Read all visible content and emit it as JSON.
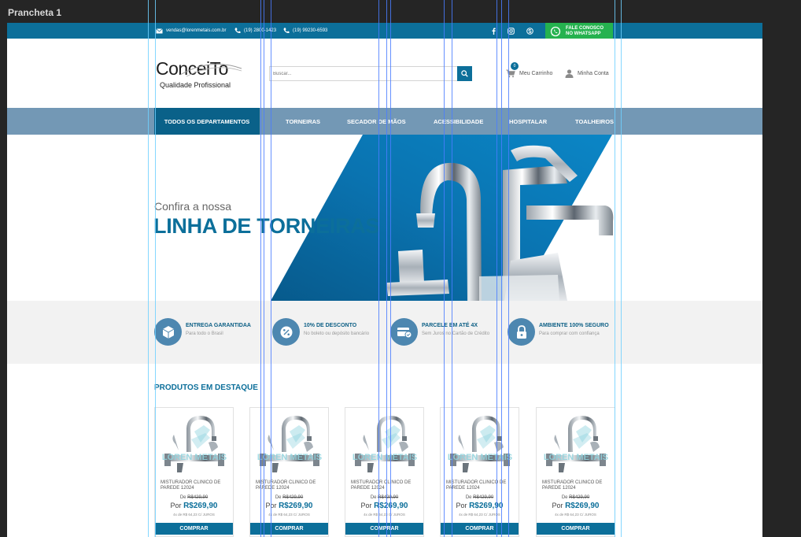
{
  "artboard": {
    "label": "Prancheta 1"
  },
  "topbar": {
    "email": "vendas@lorenmetais.com.br",
    "phone1": "(19) 2800-1423",
    "phone2": "(19) 99230-6593",
    "whatsapp_line1": "FALE CONOSCO",
    "whatsapp_line2": "NO WHATSAPP"
  },
  "header": {
    "logo_text": "ConceiTo",
    "logo_subtitle": "Qualidade Profissional",
    "search_placeholder": "Buscar...",
    "cart_label": "Meu Carrinho",
    "cart_count": "0",
    "account_label": "Minha Conta"
  },
  "nav": {
    "departments": "TODOS OS DEPARTAMENTOS",
    "items": [
      "TORNEIRAS",
      "SECADOR DE MÃOS",
      "ACESSIBILIDADE",
      "HOSPITALAR",
      "TOALHEIROS"
    ]
  },
  "hero": {
    "subtitle": "Confira a nossa",
    "title": "LINHA DE TORNEIRAS"
  },
  "benefits": [
    {
      "title": "ENTREGA GARANTIDAA",
      "text": "Para todo o Brasil",
      "icon": "box-icon"
    },
    {
      "title": "10% DE DESCONTO",
      "text": "No boleto ou depósito bancário",
      "icon": "discount-icon"
    },
    {
      "title": "PARCELE EM ATÉ 4X",
      "text": "Sem Juros no Cartão de Crédito",
      "icon": "card-icon"
    },
    {
      "title": "AMBIENTE 100% SEGURO",
      "text": "Para comprar com confiança",
      "icon": "lock-icon"
    }
  ],
  "products_section": {
    "title": "PRODUTOS EM DESTAQUE"
  },
  "products": [
    {
      "name": "MISTURADOR CLINICO DE PAREDE 12024",
      "old_prefix": "De",
      "old_price": "R$429,90",
      "price_prefix": "Por",
      "price": "R$269,90",
      "installments": "4x de R$ 64,23 C/ JUROS",
      "watermark": "LOREN METAIS",
      "buy": "COMPRAR"
    },
    {
      "name": "MISTURADOR CLINICO DE PAREDE 12024",
      "old_prefix": "De",
      "old_price": "R$429,90",
      "price_prefix": "Por",
      "price": "R$269,90",
      "installments": "4x de R$ 64,23 C/ JUROS",
      "watermark": "LOREN METAIS",
      "buy": "COMPRAR"
    },
    {
      "name": "MISTURADOR CLINICO DE PAREDE 12024",
      "old_prefix": "De",
      "old_price": "R$429,90",
      "price_prefix": "Por",
      "price": "R$269,90",
      "installments": "4x de R$ 64,23 C/ JUROS",
      "watermark": "LOREN METAIS",
      "buy": "COMPRAR"
    },
    {
      "name": "MISTURADOR CLINICO DE PAREDE 12024",
      "old_prefix": "De",
      "old_price": "R$429,90",
      "price_prefix": "Por",
      "price": "R$269,90",
      "installments": "4x de R$ 64,23 C/ JUROS",
      "watermark": "LOREN METAIS",
      "buy": "COMPRAR"
    },
    {
      "name": "MISTURADOR CLINICO DE PAREDE 12024",
      "old_prefix": "De",
      "old_price": "R$429,90",
      "price_prefix": "Por",
      "price": "R$269,90",
      "installments": "4x de R$ 64,23 C/ JUROS",
      "watermark": "LOREN METAIS",
      "buy": "COMPRAR"
    }
  ],
  "colors": {
    "primary": "#0c6f9a",
    "nav_bar": "#7398b5",
    "whatsapp": "#25b24f",
    "guide": "#4a7cff"
  }
}
